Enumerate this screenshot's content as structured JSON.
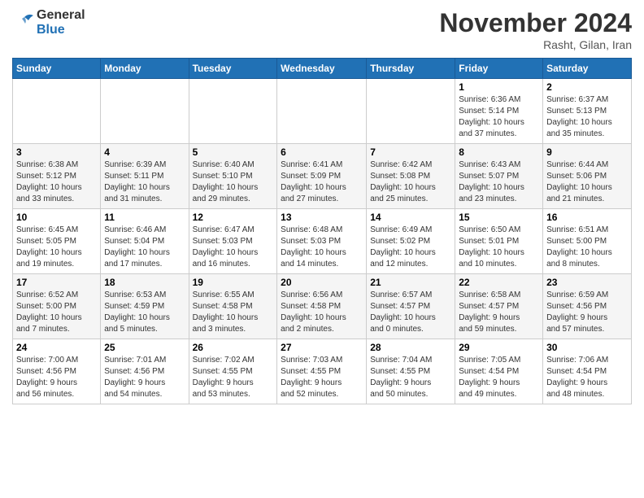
{
  "header": {
    "logo_general": "General",
    "logo_blue": "Blue",
    "month_title": "November 2024",
    "location": "Rasht, Gilan, Iran"
  },
  "weekdays": [
    "Sunday",
    "Monday",
    "Tuesday",
    "Wednesday",
    "Thursday",
    "Friday",
    "Saturday"
  ],
  "weeks": [
    [
      {
        "day": "",
        "info": ""
      },
      {
        "day": "",
        "info": ""
      },
      {
        "day": "",
        "info": ""
      },
      {
        "day": "",
        "info": ""
      },
      {
        "day": "",
        "info": ""
      },
      {
        "day": "1",
        "info": "Sunrise: 6:36 AM\nSunset: 5:14 PM\nDaylight: 10 hours\nand 37 minutes."
      },
      {
        "day": "2",
        "info": "Sunrise: 6:37 AM\nSunset: 5:13 PM\nDaylight: 10 hours\nand 35 minutes."
      }
    ],
    [
      {
        "day": "3",
        "info": "Sunrise: 6:38 AM\nSunset: 5:12 PM\nDaylight: 10 hours\nand 33 minutes."
      },
      {
        "day": "4",
        "info": "Sunrise: 6:39 AM\nSunset: 5:11 PM\nDaylight: 10 hours\nand 31 minutes."
      },
      {
        "day": "5",
        "info": "Sunrise: 6:40 AM\nSunset: 5:10 PM\nDaylight: 10 hours\nand 29 minutes."
      },
      {
        "day": "6",
        "info": "Sunrise: 6:41 AM\nSunset: 5:09 PM\nDaylight: 10 hours\nand 27 minutes."
      },
      {
        "day": "7",
        "info": "Sunrise: 6:42 AM\nSunset: 5:08 PM\nDaylight: 10 hours\nand 25 minutes."
      },
      {
        "day": "8",
        "info": "Sunrise: 6:43 AM\nSunset: 5:07 PM\nDaylight: 10 hours\nand 23 minutes."
      },
      {
        "day": "9",
        "info": "Sunrise: 6:44 AM\nSunset: 5:06 PM\nDaylight: 10 hours\nand 21 minutes."
      }
    ],
    [
      {
        "day": "10",
        "info": "Sunrise: 6:45 AM\nSunset: 5:05 PM\nDaylight: 10 hours\nand 19 minutes."
      },
      {
        "day": "11",
        "info": "Sunrise: 6:46 AM\nSunset: 5:04 PM\nDaylight: 10 hours\nand 17 minutes."
      },
      {
        "day": "12",
        "info": "Sunrise: 6:47 AM\nSunset: 5:03 PM\nDaylight: 10 hours\nand 16 minutes."
      },
      {
        "day": "13",
        "info": "Sunrise: 6:48 AM\nSunset: 5:03 PM\nDaylight: 10 hours\nand 14 minutes."
      },
      {
        "day": "14",
        "info": "Sunrise: 6:49 AM\nSunset: 5:02 PM\nDaylight: 10 hours\nand 12 minutes."
      },
      {
        "day": "15",
        "info": "Sunrise: 6:50 AM\nSunset: 5:01 PM\nDaylight: 10 hours\nand 10 minutes."
      },
      {
        "day": "16",
        "info": "Sunrise: 6:51 AM\nSunset: 5:00 PM\nDaylight: 10 hours\nand 8 minutes."
      }
    ],
    [
      {
        "day": "17",
        "info": "Sunrise: 6:52 AM\nSunset: 5:00 PM\nDaylight: 10 hours\nand 7 minutes."
      },
      {
        "day": "18",
        "info": "Sunrise: 6:53 AM\nSunset: 4:59 PM\nDaylight: 10 hours\nand 5 minutes."
      },
      {
        "day": "19",
        "info": "Sunrise: 6:55 AM\nSunset: 4:58 PM\nDaylight: 10 hours\nand 3 minutes."
      },
      {
        "day": "20",
        "info": "Sunrise: 6:56 AM\nSunset: 4:58 PM\nDaylight: 10 hours\nand 2 minutes."
      },
      {
        "day": "21",
        "info": "Sunrise: 6:57 AM\nSunset: 4:57 PM\nDaylight: 10 hours\nand 0 minutes."
      },
      {
        "day": "22",
        "info": "Sunrise: 6:58 AM\nSunset: 4:57 PM\nDaylight: 9 hours\nand 59 minutes."
      },
      {
        "day": "23",
        "info": "Sunrise: 6:59 AM\nSunset: 4:56 PM\nDaylight: 9 hours\nand 57 minutes."
      }
    ],
    [
      {
        "day": "24",
        "info": "Sunrise: 7:00 AM\nSunset: 4:56 PM\nDaylight: 9 hours\nand 56 minutes."
      },
      {
        "day": "25",
        "info": "Sunrise: 7:01 AM\nSunset: 4:56 PM\nDaylight: 9 hours\nand 54 minutes."
      },
      {
        "day": "26",
        "info": "Sunrise: 7:02 AM\nSunset: 4:55 PM\nDaylight: 9 hours\nand 53 minutes."
      },
      {
        "day": "27",
        "info": "Sunrise: 7:03 AM\nSunset: 4:55 PM\nDaylight: 9 hours\nand 52 minutes."
      },
      {
        "day": "28",
        "info": "Sunrise: 7:04 AM\nSunset: 4:55 PM\nDaylight: 9 hours\nand 50 minutes."
      },
      {
        "day": "29",
        "info": "Sunrise: 7:05 AM\nSunset: 4:54 PM\nDaylight: 9 hours\nand 49 minutes."
      },
      {
        "day": "30",
        "info": "Sunrise: 7:06 AM\nSunset: 4:54 PM\nDaylight: 9 hours\nand 48 minutes."
      }
    ]
  ]
}
